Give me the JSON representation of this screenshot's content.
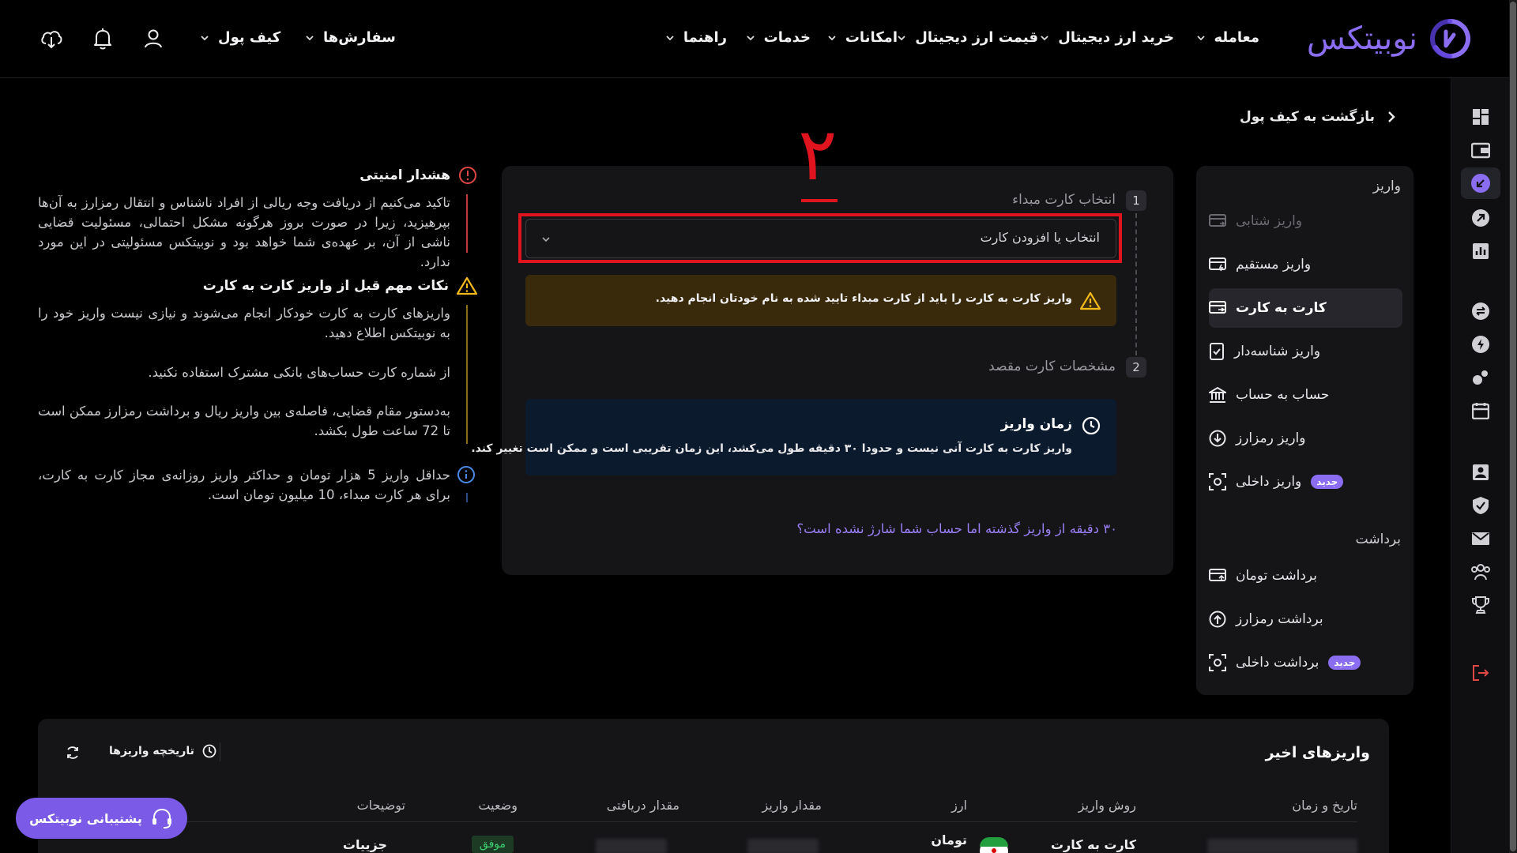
{
  "brand": {
    "name": "نوبیتکس",
    "accent": "#8b6df2"
  },
  "header": {
    "nav": [
      "معامله",
      "خرید ارز دیجیتال",
      "قیمت ارز دیجیتال",
      "امکانات",
      "خدمات",
      "راهنما"
    ],
    "orders": "سفارش‌ها",
    "wallet": "کیف پول"
  },
  "back_link": "بازگشت به کیف پول",
  "annotation_number": "۲",
  "sidebar": {
    "deposit_heading": "واریز",
    "deposit_items": [
      {
        "label": "واریز شتابی",
        "icon": "card-out-icon",
        "disabled": true
      },
      {
        "label": "واریز مستقیم",
        "icon": "card-lightning-icon"
      },
      {
        "label": "کارت به کارت",
        "icon": "card-transfer-icon",
        "active": true
      },
      {
        "label": "واریز شناسه‌دار",
        "icon": "check-doc-icon"
      },
      {
        "label": "حساب به حساب",
        "icon": "bank-icon"
      },
      {
        "label": "واریز رمزارز",
        "icon": "download-circle-icon"
      },
      {
        "label": "واریز داخلی",
        "icon": "scan-icon",
        "badge": "جدید"
      }
    ],
    "withdraw_heading": "برداشت",
    "withdraw_items": [
      {
        "label": "برداشت تومان",
        "icon": "card-up-icon"
      },
      {
        "label": "برداشت رمزارز",
        "icon": "upload-circle-icon"
      },
      {
        "label": "برداشت داخلی",
        "icon": "scan-icon",
        "badge": "جدید"
      }
    ]
  },
  "form": {
    "step1_num": "1",
    "step1_label": "انتخاب کارت مبداء",
    "select_placeholder": "انتخاب یا افزودن کارت",
    "warning": "واریز کارت به کارت را باید از کارت مبداء تایید شده به نام خودتان انجام دهید.",
    "step2_num": "2",
    "step2_label": "مشخصات کارت مقصد",
    "time_title": "زمان واریز",
    "time_body": "واریز کارت به کارت آنی نیست و حدودا ۳۰ دقیقه طول می‌کشد، این زمان تقریبی است و ممکن است تغییر کند.",
    "help_link": "۳۰ دقیقه از واریز گذشته اما حساب شما شارژ نشده است؟"
  },
  "notes": {
    "security_title": "هشدار امنیتی",
    "security_body": "تاکید می‌کنیم از دریافت وجه ریالی از افراد ناشناس و انتقال رمزارز به آن‌ها بپرهیزید، زیرا در صورت بروز هرگونه مشکل احتمالی، مسئولیت قضایی ناشی از آن، بر عهده‌ی شما خواهد بود و نوبیتکس مسئولیتی در این مورد ندارد.",
    "tips_title": "نکات مهم قبل از واریز کارت به کارت",
    "tip1": "واریزهای کارت به کارت خودکار انجام می‌شوند و نیازی نیست واریز خود را به نوبیتکس اطلاع دهید.",
    "tip2": "از شماره کارت حساب‌های بانکی مشترک استفاده نکنید.",
    "tip3": "به‌دستور مقام قضایی، فاصله‌ی بین واریز ریال و برداشت رمزارز ممکن است تا 72 ساعت طول بکشد.",
    "limit": "حداقل واریز 5 هزار تومان و حداکثر واریز روزانه‌ی مجاز کارت به کارت، برای هر کارت مبداء، 10 میلیون تومان است."
  },
  "recent": {
    "title": "واریزهای اخیر",
    "history_label": "تاریخچه واریزها",
    "columns": [
      "تاریخ و زمان",
      "روش واریز",
      "ارز",
      "مقدار واریز",
      "مقدار دریافتی",
      "وضعیت",
      "توضیحات"
    ],
    "row": {
      "method": "کارت به کارت",
      "currency": "تومان",
      "status": "موفق",
      "details": "جزییات"
    }
  },
  "support": "پشتیبانی نوبیتکس"
}
